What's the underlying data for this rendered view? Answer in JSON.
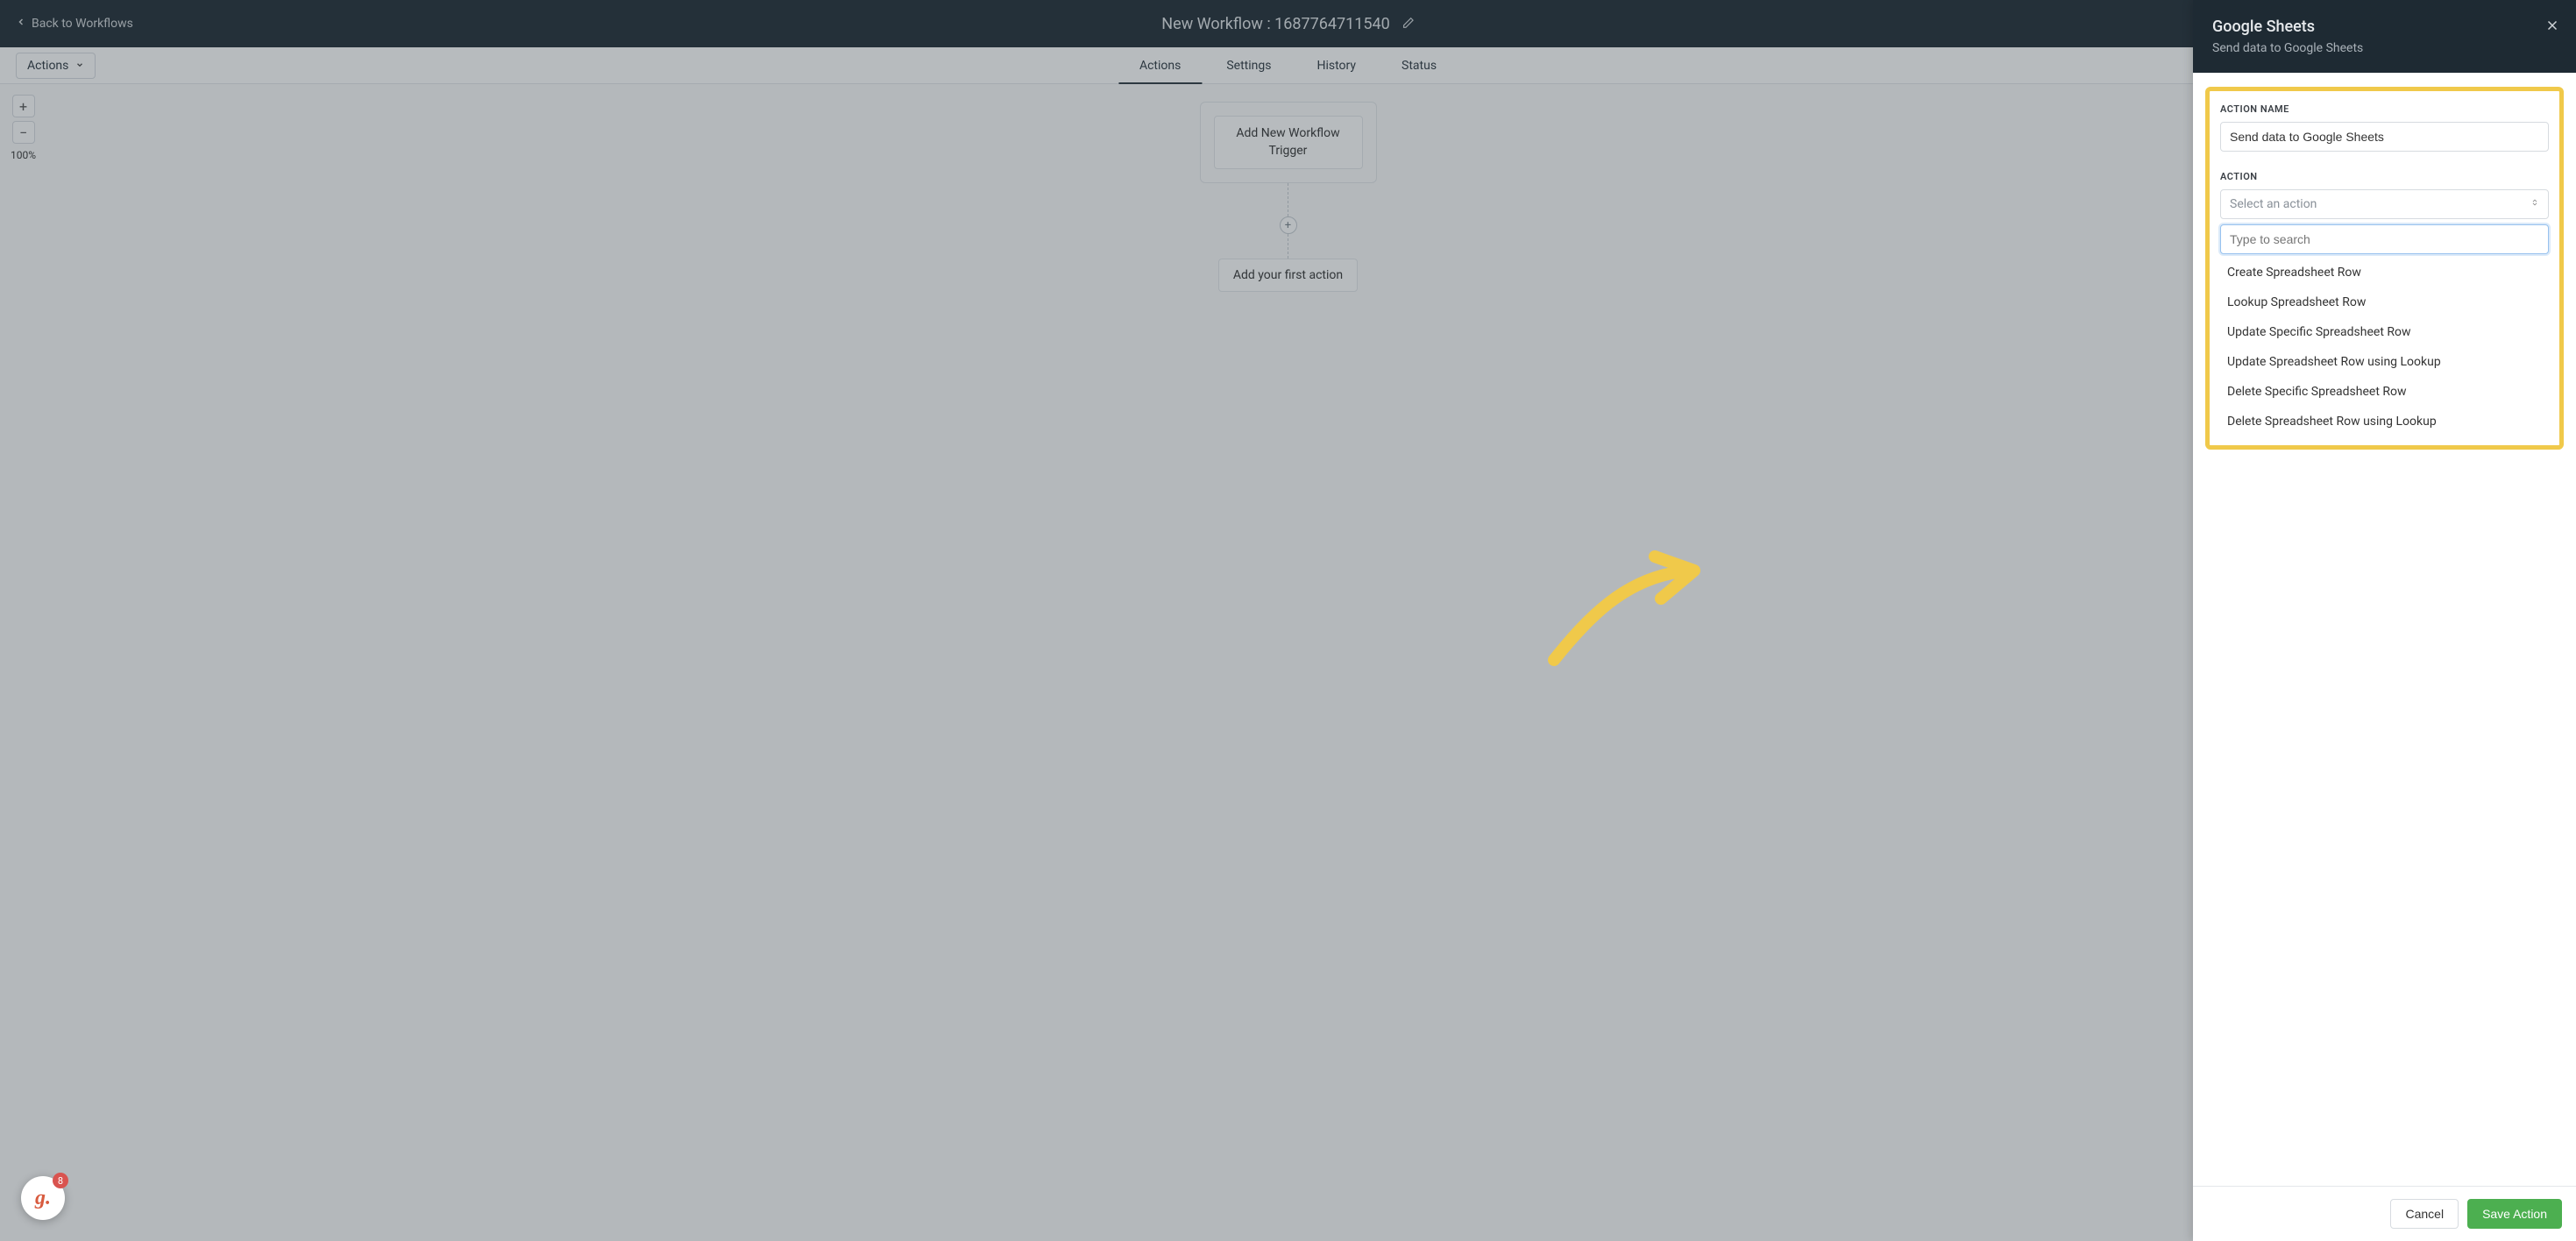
{
  "header": {
    "back_label": "Back to Workflows",
    "title": "New Workflow : 1687764711540"
  },
  "toolbar": {
    "actions_label": "Actions"
  },
  "tabs": {
    "actions": "Actions",
    "settings": "Settings",
    "history": "History",
    "status": "Status"
  },
  "canvas": {
    "zoom_level": "100%",
    "trigger_line1": "Add New Workflow",
    "trigger_line2": "Trigger",
    "first_action": "Add your first action"
  },
  "chat": {
    "badge": "8",
    "glyph": "g."
  },
  "panel": {
    "title": "Google Sheets",
    "subtitle": "Send data to Google Sheets",
    "action_name_label": "ACTION NAME",
    "action_name_value": "Send data to Google Sheets",
    "action_label": "ACTION",
    "select_placeholder": "Select an action",
    "search_placeholder": "Type to search",
    "options": {
      "o1": "Create Spreadsheet Row",
      "o2": "Lookup Spreadsheet Row",
      "o3": "Update Specific Spreadsheet Row",
      "o4": "Update Spreadsheet Row using Lookup",
      "o5": "Delete Specific Spreadsheet Row",
      "o6": "Delete Spreadsheet Row using Lookup"
    },
    "cancel": "Cancel",
    "save": "Save Action"
  }
}
